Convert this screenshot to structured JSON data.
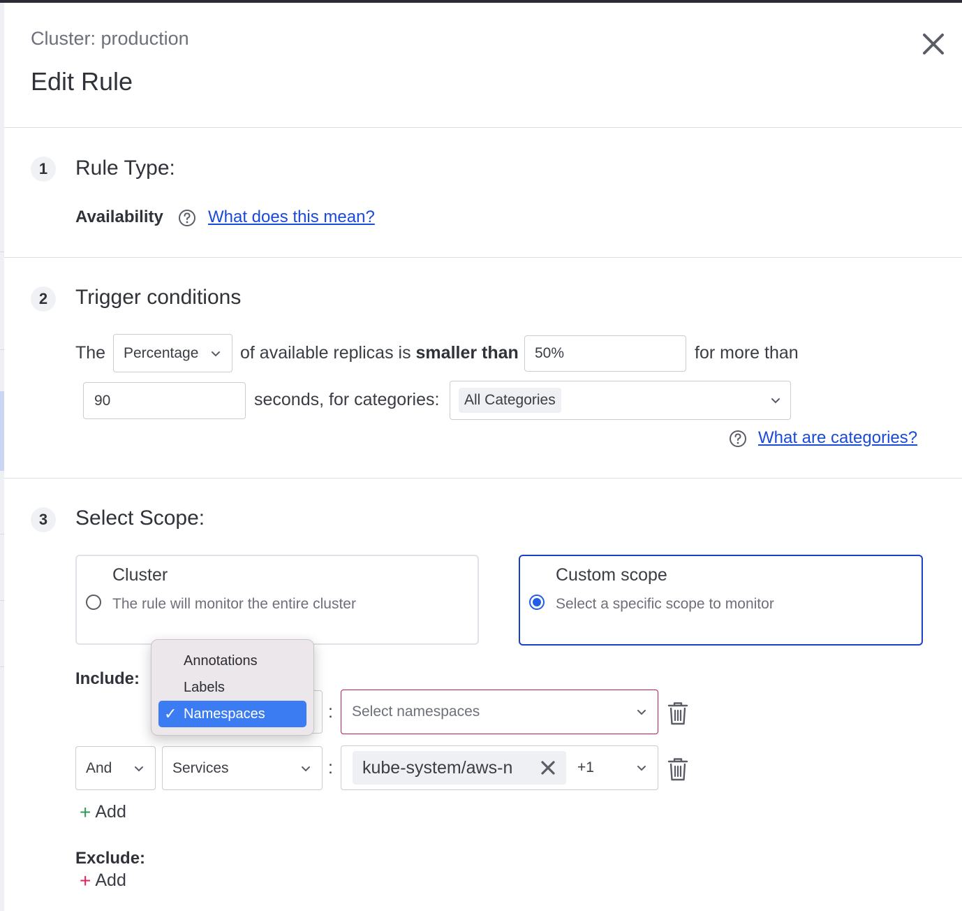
{
  "header": {
    "cluster_label": "Cluster: production",
    "title": "Edit Rule"
  },
  "steps": {
    "rule_type": {
      "number": "1",
      "title": "Rule Type:",
      "type_value": "Availability",
      "help_link": "What does this mean?"
    },
    "trigger": {
      "number": "2",
      "title": "Trigger conditions",
      "prefix": "The",
      "measure_select": "Percentage",
      "middle_text": "of available replicas is",
      "comparator": "smaller than",
      "threshold_value": "50%",
      "suffix": "for more than",
      "duration_value": "90",
      "duration_text": "seconds, for categories:",
      "categories_chip": "All Categories",
      "categories_link": "What are categories?"
    },
    "scope": {
      "number": "3",
      "title": "Select Scope:",
      "cluster_option": {
        "title": "Cluster",
        "description": "The rule will monitor the entire cluster"
      },
      "custom_option": {
        "title": "Custom scope",
        "description": "Select a specific scope to monitor"
      },
      "include_label": "Include:",
      "row1": {
        "value_placeholder": "Select namespaces",
        "separator": ":"
      },
      "row2": {
        "operator": "And",
        "key": "Services",
        "separator": ":",
        "chip": "kube-system/aws-n",
        "more_count": "+1"
      },
      "include_add": "Add",
      "exclude_label": "Exclude:",
      "exclude_add": "Add"
    }
  },
  "key_dropdown": {
    "options": [
      "Annotations",
      "Labels",
      "Namespaces"
    ],
    "selected": "Namespaces"
  },
  "colors": {
    "accent_blue": "#1d3fc7",
    "link_blue": "#1a4ad8",
    "add_green": "#2e9b58",
    "exclude_pink": "#e0245e",
    "invalid_border": "#c2185b"
  }
}
